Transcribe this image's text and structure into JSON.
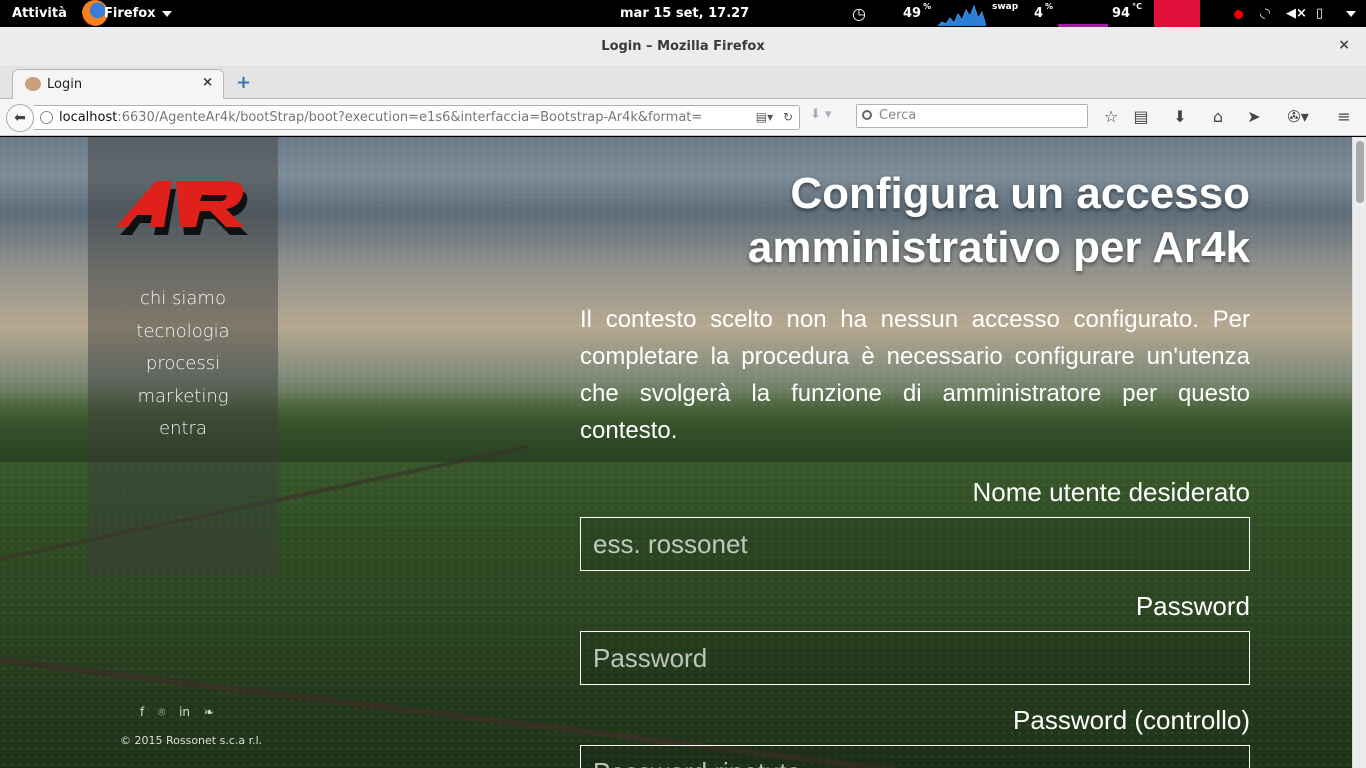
{
  "topbar": {
    "activities": "Attività",
    "app": "Firefox",
    "clock": "mar 15 set, 17.27",
    "cpu": "49",
    "cpu_unit": "%",
    "swap_label": "swap",
    "swap": "4",
    "swap_unit": "%",
    "temp": "94",
    "temp_unit": "°C"
  },
  "window": {
    "title": "Login – Mozilla Firefox",
    "close": "×"
  },
  "tabs": [
    {
      "label": "Login",
      "close": "×"
    }
  ],
  "newtab": "+",
  "nav": {
    "url_host": "localhost",
    "url_rest": ":6630/AgenteAr4k/bootStrap/boot?execution=e1s6&interfaccia=Bootstrap-Ar4k&format=",
    "search_placeholder": "Cerca"
  },
  "sidebar": {
    "logo_text": "AR",
    "menu": [
      "chi siamo",
      "tecnologia",
      "processi",
      "marketing",
      "entra"
    ],
    "social": [
      "f",
      "⌾",
      "in",
      "❧"
    ],
    "copyright": "© 2015 Rossonet s.c.a r.l."
  },
  "main": {
    "heading_line1": "Configura un accesso",
    "heading_line2": "amministrativo per Ar4k",
    "intro": "Il contesto scelto non ha nessun accesso configurato. Per completare la procedura è necessario configurare un'utenza che svolgerà la funzione di amministratore per questo contesto.",
    "username_label": "Nome utente desiderato",
    "username_placeholder": "ess. rossonet",
    "password_label": "Password",
    "password_placeholder": "Password",
    "password2_label": "Password (controllo)",
    "password2_placeholder": "Password ripetuta"
  },
  "colors": {
    "logo_red": "#e0201a",
    "logo_black": "#111111"
  }
}
